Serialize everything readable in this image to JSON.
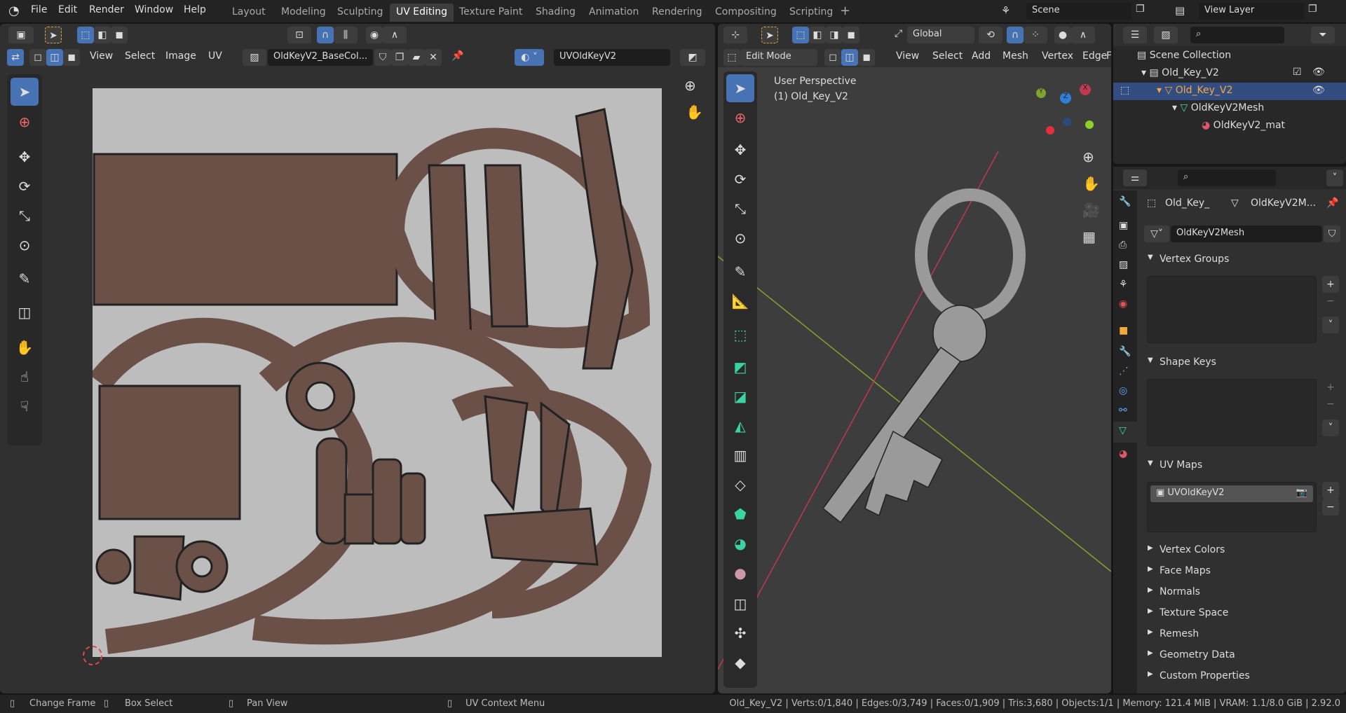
{
  "menu": [
    "File",
    "Edit",
    "Render",
    "Window",
    "Help"
  ],
  "workspaces": [
    "Layout",
    "Modeling",
    "Sculpting",
    "UV Editing",
    "Texture Paint",
    "Shading",
    "Animation",
    "Rendering",
    "Compositing",
    "Scripting"
  ],
  "active_workspace": "UV Editing",
  "scene": "Scene",
  "view_layer": "View Layer",
  "uv_editor": {
    "menus": [
      "View",
      "Select",
      "Image",
      "UV"
    ],
    "image_name": "OldKeyV2_BaseCol...",
    "uv_map": "UVOldKeyV2"
  },
  "viewport": {
    "transform_orientation": "Global",
    "mode": "Edit Mode",
    "menus": [
      "View",
      "Select",
      "Add",
      "Mesh",
      "Vertex",
      "Edge",
      "F"
    ],
    "perspective_label": "User Perspective",
    "object_label": "(1) Old_Key_V2",
    "axes": {
      "x": "X",
      "y": "Y",
      "z": "Z"
    }
  },
  "outliner": {
    "items": [
      {
        "label": "Scene Collection"
      },
      {
        "label": "Old_Key_V2"
      },
      {
        "label": "Old_Key_V2"
      },
      {
        "label": "OldKeyV2Mesh"
      },
      {
        "label": "OldKeyV2_mat"
      }
    ]
  },
  "properties": {
    "breadcrumb_object": "Old_Key_",
    "breadcrumb_mesh": "OldKeyV2M...",
    "mesh_name": "OldKeyV2Mesh",
    "panels": {
      "vertex_groups": "Vertex Groups",
      "shape_keys": "Shape Keys",
      "uv_maps": "UV Maps",
      "uv_map_item": "UVOldKeyV2",
      "collapsed": [
        "Vertex Colors",
        "Face Maps",
        "Normals",
        "Texture Space",
        "Remesh",
        "Geometry Data",
        "Custom Properties"
      ]
    }
  },
  "status": {
    "hints": [
      "Change Frame",
      "Box Select",
      "Pan View",
      "UV Context Menu"
    ],
    "stats": "Old_Key_V2 | Verts:0/1,840 | Edges:0/3,749 | Faces:0/1,909 | Tris:3,680 | Objects:1/1 | Memory: 121.4 MiB | VRAM: 1.1/8.0 GiB | 2.92.0"
  },
  "colors": {
    "accent": "#4772b3",
    "selected_object": "#f4a93c",
    "mesh_green": "#3cd3a4",
    "x_axis": "#c0394e",
    "y_axis": "#7fa42f",
    "uv_island": "#6b5048"
  }
}
